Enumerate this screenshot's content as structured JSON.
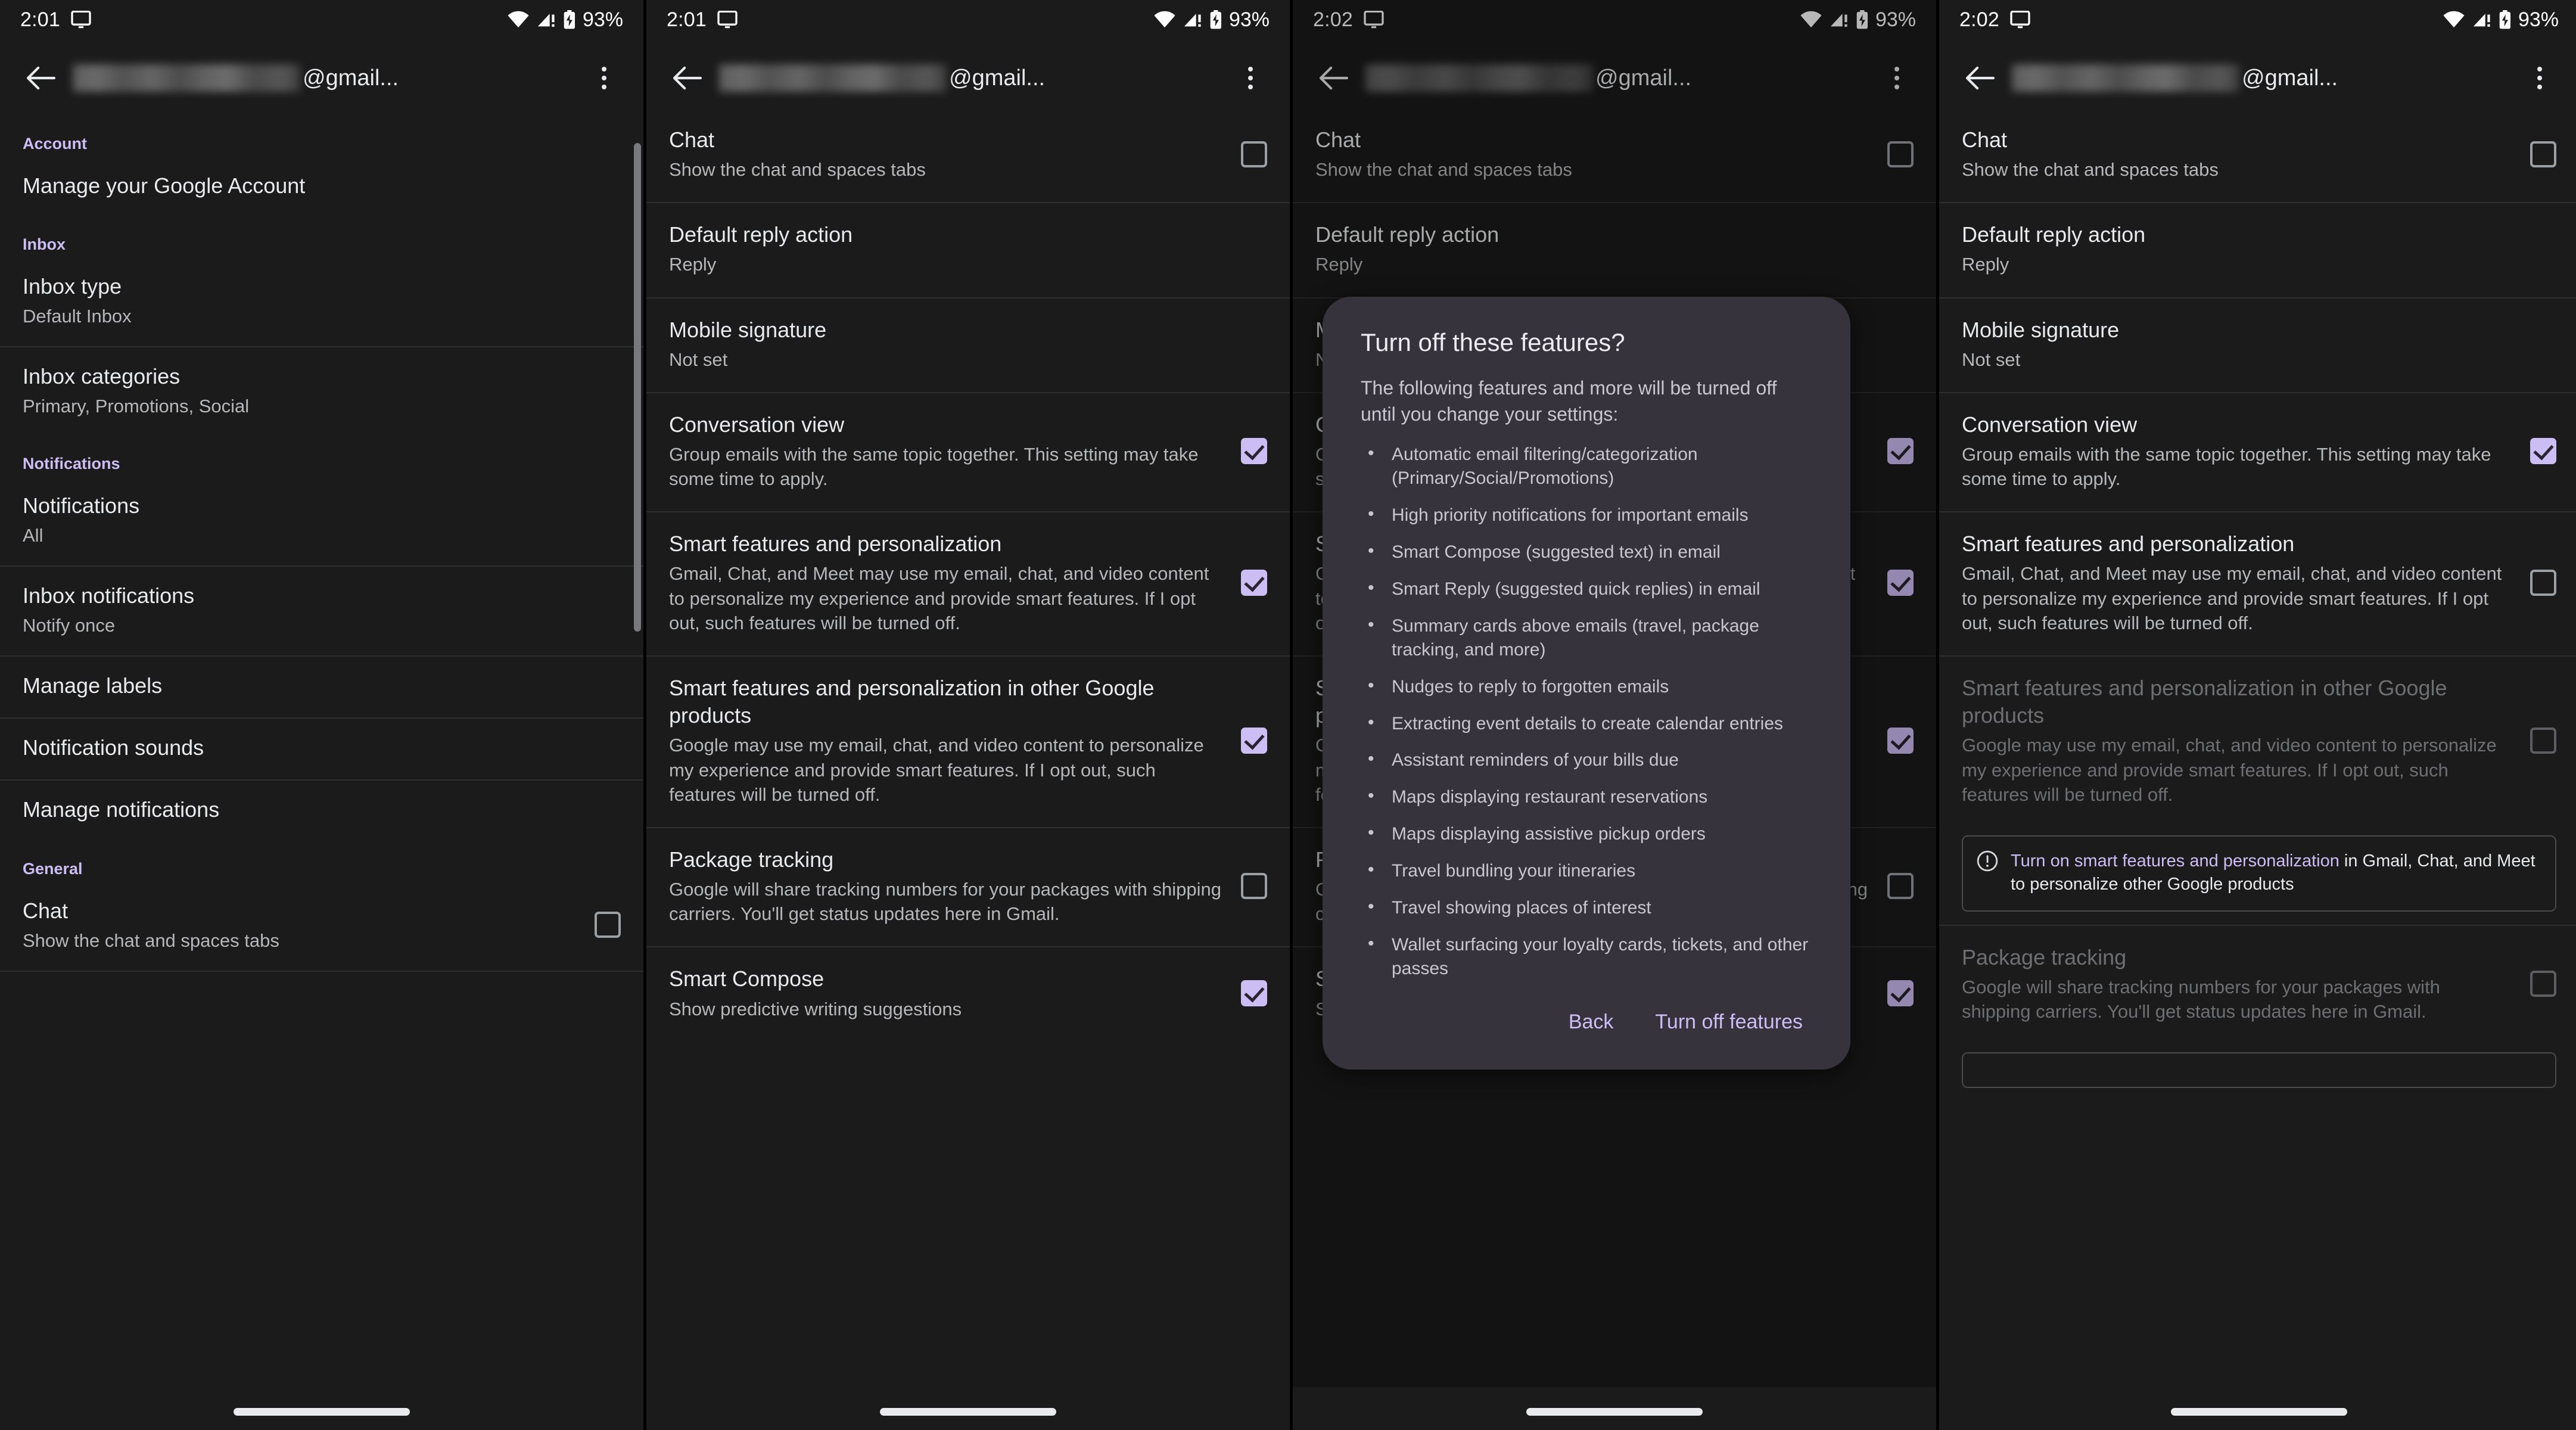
{
  "status_bar": {
    "time_left": "2:01",
    "time_right": "2:02",
    "battery": "93%",
    "icons": [
      "cast-icon",
      "wifi-icon",
      "cellular-alert-icon",
      "battery-charging-icon"
    ]
  },
  "toolbar": {
    "account_suffix": "@gmail...",
    "back_icon": "back-arrow-icon",
    "overflow_icon": "kebab-menu-icon"
  },
  "panel1": {
    "sections": [
      {
        "header": "Account",
        "rows": [
          {
            "title": "Manage your Google Account",
            "sub": ""
          }
        ]
      },
      {
        "header": "Inbox",
        "rows": [
          {
            "title": "Inbox type",
            "sub": "Default Inbox"
          },
          {
            "title": "Inbox categories",
            "sub": "Primary, Promotions, Social"
          }
        ]
      },
      {
        "header": "Notifications",
        "rows": [
          {
            "title": "Notifications",
            "sub": "All"
          },
          {
            "title": "Inbox notifications",
            "sub": "Notify once"
          },
          {
            "title": "Manage labels",
            "sub": ""
          },
          {
            "title": "Notification sounds",
            "sub": ""
          },
          {
            "title": "Manage notifications",
            "sub": ""
          }
        ]
      },
      {
        "header": "General",
        "rows": [
          {
            "title": "Chat",
            "sub": "Show the chat and spaces tabs",
            "checkbox": "off"
          }
        ]
      }
    ]
  },
  "settings_rows": {
    "chat": {
      "title": "Chat",
      "sub": "Show the chat and spaces tabs"
    },
    "default_reply": {
      "title": "Default reply action",
      "sub": "Reply"
    },
    "mobile_signature": {
      "title": "Mobile signature",
      "sub": "Not set"
    },
    "conversation_view": {
      "title": "Conversation view",
      "sub": "Group emails with the same topic together. This setting may take some time to apply."
    },
    "smart_features": {
      "title": "Smart features and personalization",
      "sub": "Gmail, Chat, and Meet may use my email, chat, and video content to personalize my experience and provide smart features. If I opt out, such features will be turned off."
    },
    "smart_features_other": {
      "title": "Smart features and personalization in other Google products",
      "sub": "Google may use my email, chat, and video content to personalize my experience and provide smart features. If I opt out, such features will be turned off."
    },
    "package_tracking": {
      "title": "Package tracking",
      "sub": "Google will share tracking numbers for your packages with shipping carriers. You'll get status updates here in Gmail."
    },
    "smart_compose": {
      "title": "Smart Compose",
      "sub": "Show predictive writing suggestions"
    }
  },
  "panel2_checkboxes": {
    "chat": "off",
    "conversation_view": "on",
    "smart_features": "on",
    "smart_features_other": "on",
    "package_tracking": "off",
    "smart_compose": "on"
  },
  "panel4_checkboxes": {
    "chat": "off",
    "conversation_view": "on",
    "smart_features": "off",
    "smart_features_other": "off",
    "package_tracking": "off"
  },
  "dialog": {
    "title": "Turn off these features?",
    "body": "The following features and more will be turned off until you change your settings:",
    "items": [
      "Automatic email filtering/categorization (Primary/Social/Promotions)",
      "High priority notifications for important emails",
      "Smart Compose (suggested text) in email",
      "Smart Reply (suggested quick replies) in email",
      "Summary cards above emails (travel, package tracking, and more)",
      "Nudges to reply to forgotten emails",
      "Extracting event details to create calendar entries",
      "Assistant reminders of your bills due",
      "Maps displaying restaurant reservations",
      "Maps displaying assistive pickup orders",
      "Travel bundling your itineraries",
      "Travel showing places of interest",
      "Wallet surfacing your loyalty cards, tickets, and other passes"
    ],
    "back_label": "Back",
    "confirm_label": "Turn off features"
  },
  "banner": {
    "icon": "info-icon",
    "link_text": "Turn on smart features and personalization",
    "rest_text": " in Gmail, Chat, and Meet to personalize other Google products"
  },
  "colors": {
    "accent": "#cdbdf5",
    "background": "#1b1b1b",
    "dialog_bg": "#36333c",
    "divider": "#2e2f31",
    "text_primary": "#e8eaed",
    "text_secondary": "#b5b7ba",
    "text_disabled": "#6d6f72"
  }
}
